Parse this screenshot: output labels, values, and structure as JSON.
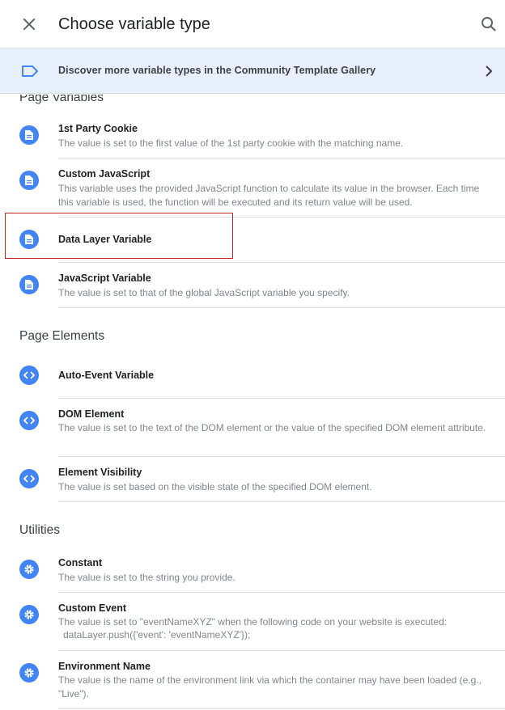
{
  "header": {
    "title": "Choose variable type",
    "close_icon": "close-icon",
    "search_icon": "search-icon"
  },
  "banner": {
    "text": "Discover more variable types in the Community Template Gallery",
    "icon": "label-icon",
    "chevron": "chevron-right-icon"
  },
  "sections": {
    "page_variables": "Page Variables",
    "page_elements": "Page Elements",
    "utilities": "Utilities"
  },
  "items": {
    "first_party_cookie": {
      "name": "1st Party Cookie",
      "desc": "The value is set to the first value of the 1st party cookie with the matching name.",
      "icon": "document-icon"
    },
    "custom_javascript": {
      "name": "Custom JavaScript",
      "desc": "This variable uses the provided JavaScript function to calculate its value in the browser. Each time this variable is used, the function will be executed and its return value will be used.",
      "icon": "document-icon"
    },
    "data_layer_variable": {
      "name": "Data Layer Variable",
      "desc": "",
      "icon": "document-icon"
    },
    "javascript_variable": {
      "name": "JavaScript Variable",
      "desc": "The value is set to that of the global JavaScript variable you specify.",
      "icon": "document-icon"
    },
    "auto_event_variable": {
      "name": "Auto-Event Variable",
      "desc": "",
      "icon": "code-icon"
    },
    "dom_element": {
      "name": "DOM Element",
      "desc": "The value is set to the text of the DOM element or the value of the specified DOM element attribute.",
      "icon": "code-icon"
    },
    "element_visibility": {
      "name": "Element Visibility",
      "desc": "The value is set based on the visible state of the specified DOM element.",
      "icon": "code-icon"
    },
    "constant": {
      "name": "Constant",
      "desc": "The value is set to the string you provide.",
      "icon": "gear-icon"
    },
    "custom_event": {
      "name": "Custom Event",
      "desc_line1": "The value is set to \"eventNameXYZ\" when the following code on your website is executed:",
      "desc_line2": "dataLayer.push({'event': 'eventNameXYZ'});",
      "icon": "gear-icon"
    },
    "environment_name": {
      "name": "Environment Name",
      "desc": "The value is the name of the environment link via which the container may have been loaded (e.g., \"Live\").",
      "icon": "gear-icon"
    }
  },
  "colors": {
    "accent": "#4285f4",
    "banner_bg": "#e8f0fe",
    "highlight_border": "#c5221f"
  }
}
